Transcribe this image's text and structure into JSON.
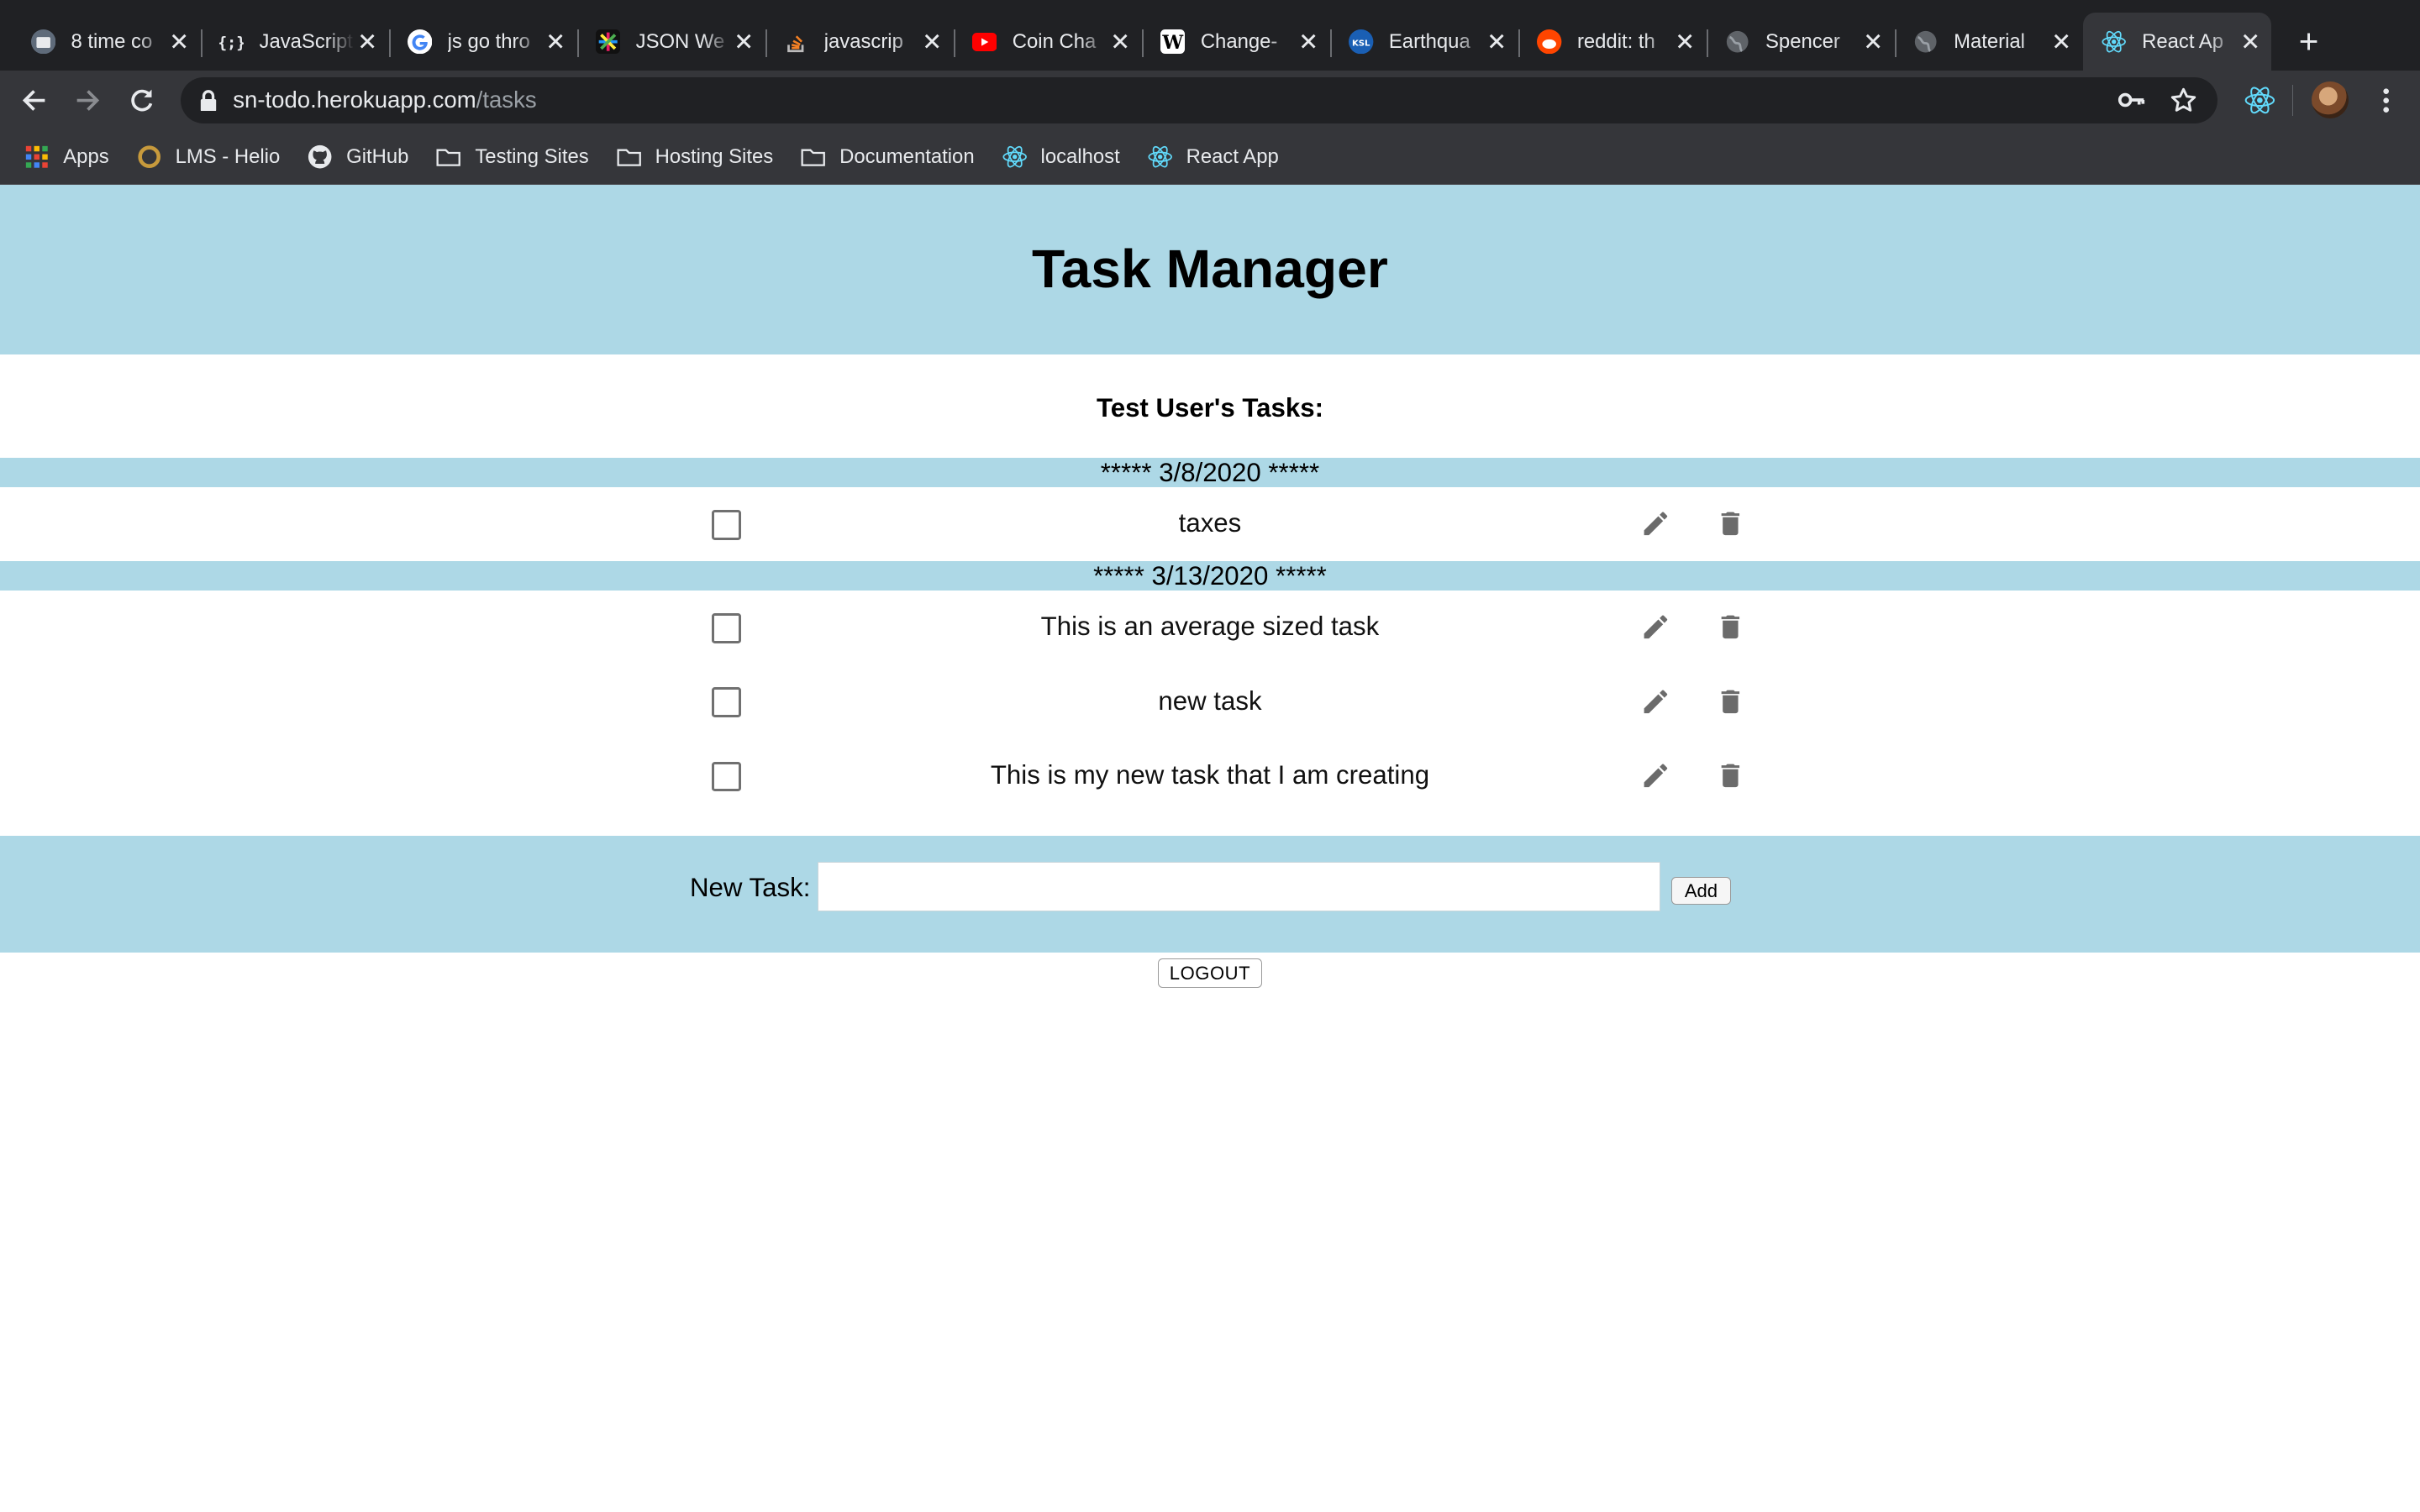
{
  "browser": {
    "tabs": [
      {
        "title": "8 time co",
        "icon": "eight-time-favicon",
        "color": "#5f6b7a",
        "active": false
      },
      {
        "title": "JavaScript",
        "icon": "code-braces-favicon",
        "color": "#202124",
        "active": false
      },
      {
        "title": "js go thro",
        "icon": "google-favicon",
        "color": "#ffffff",
        "active": false
      },
      {
        "title": "JSON We",
        "icon": "json-favicon",
        "color": "#111111",
        "active": false
      },
      {
        "title": "javascrip",
        "icon": "stackoverflow-favicon",
        "color": "#f48024",
        "active": false
      },
      {
        "title": "Coin Cha",
        "icon": "youtube-favicon",
        "color": "#ff0000",
        "active": false
      },
      {
        "title": "Change-",
        "icon": "wikipedia-favicon",
        "color": "#ffffff",
        "active": false
      },
      {
        "title": "Earthqua",
        "icon": "ksl-favicon",
        "color": "#1a5fb4",
        "active": false
      },
      {
        "title": "reddit: th",
        "icon": "reddit-favicon",
        "color": "#ff4500",
        "active": false
      },
      {
        "title": "Spencer",
        "icon": "globe-favicon",
        "color": "#5f6368",
        "active": false
      },
      {
        "title": "Material",
        "icon": "globe-favicon",
        "color": "#5f6368",
        "active": false
      },
      {
        "title": "React Ap",
        "icon": "react-favicon",
        "color": "#61dafb",
        "active": true
      }
    ],
    "url_host": "sn-todo.herokuapp.com",
    "url_path": "/tasks",
    "bookmarks": [
      {
        "label": "Apps",
        "icon": "apps-grid-icon"
      },
      {
        "label": "LMS - Helio",
        "icon": "helio-icon"
      },
      {
        "label": "GitHub",
        "icon": "github-icon"
      },
      {
        "label": "Testing Sites",
        "icon": "folder-icon"
      },
      {
        "label": "Hosting Sites",
        "icon": "folder-icon"
      },
      {
        "label": "Documentation",
        "icon": "folder-icon"
      },
      {
        "label": "localhost",
        "icon": "react-icon"
      },
      {
        "label": "React App",
        "icon": "react-icon"
      }
    ]
  },
  "app": {
    "title": "Task Manager",
    "subtitle": "Test User's Tasks:",
    "accent_color": "#add8e6",
    "groups": [
      {
        "date_label": "***** 3/8/2020 *****",
        "tasks": [
          {
            "text": "taxes",
            "done": false
          }
        ]
      },
      {
        "date_label": "***** 3/13/2020 *****",
        "tasks": [
          {
            "text": "This is an average sized task",
            "done": false
          },
          {
            "text": "new task",
            "done": false
          },
          {
            "text": "This is my new task that I am creating",
            "done": false
          }
        ]
      }
    ],
    "new_task": {
      "label": "New Task:",
      "value": "",
      "placeholder": "",
      "add_label": "Add"
    },
    "logout_label": "LOGOUT"
  }
}
